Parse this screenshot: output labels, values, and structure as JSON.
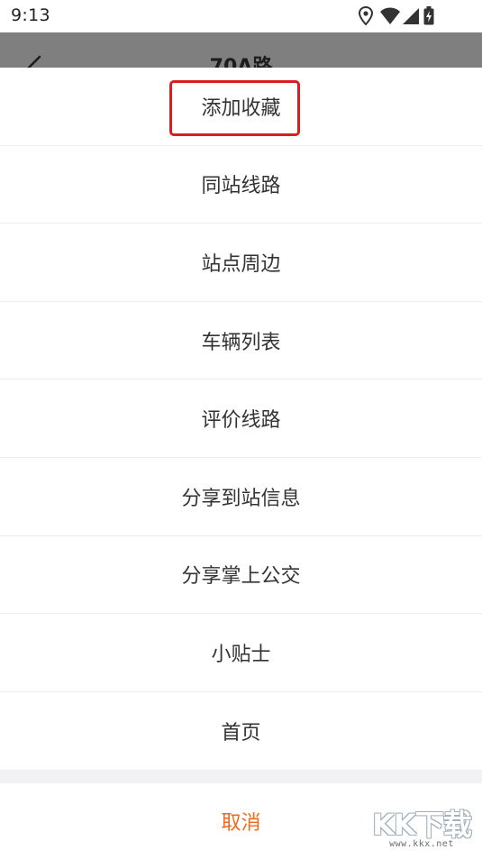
{
  "status_bar": {
    "time": "9:13",
    "icons": [
      "location-icon",
      "wifi-icon",
      "signal-icon",
      "battery-charging-icon"
    ]
  },
  "header": {
    "title": "70A路"
  },
  "menu": {
    "items": [
      {
        "label": "添加收藏",
        "highlighted": true
      },
      {
        "label": "同站线路"
      },
      {
        "label": "站点周边"
      },
      {
        "label": "车辆列表"
      },
      {
        "label": "评价线路"
      },
      {
        "label": "分享到站信息"
      },
      {
        "label": "分享掌上公交"
      },
      {
        "label": "小贴士"
      },
      {
        "label": "首页"
      }
    ],
    "cancel_label": "取消"
  },
  "colors": {
    "overlay_header": "#7f7f7f",
    "highlight_border": "#d81e1e",
    "cancel_text": "#f06a1d",
    "divider": "#ececec"
  },
  "watermark": {
    "mark": "KK下载",
    "url": "www.kkx.net"
  }
}
